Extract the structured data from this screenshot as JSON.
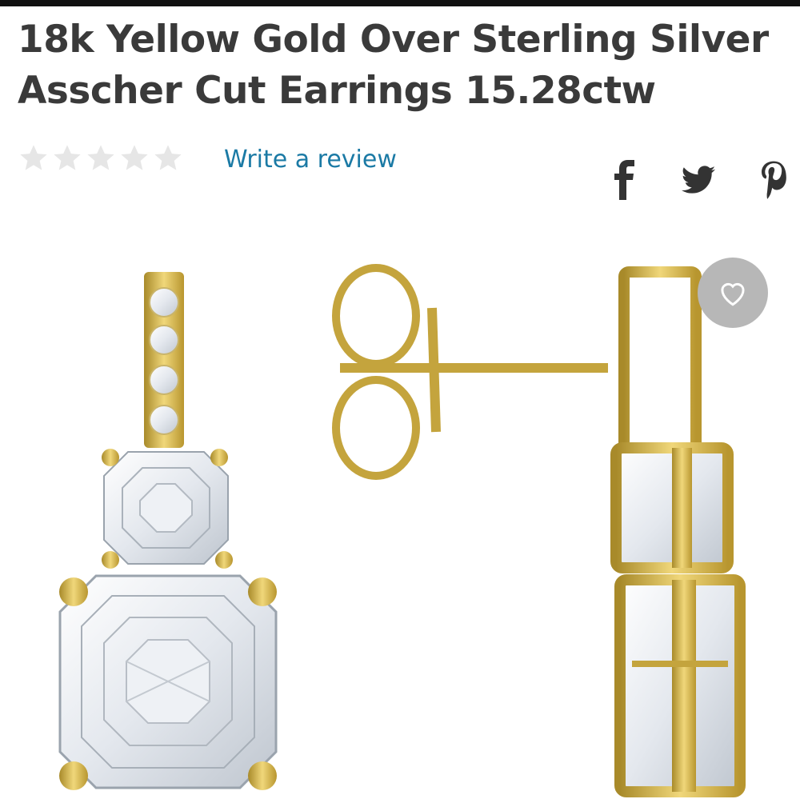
{
  "product": {
    "title": "18k Yellow Gold Over Sterling Silver Asscher Cut Earrings 15.28ctw"
  },
  "rating": {
    "stars_filled": 0,
    "stars_total": 5
  },
  "review": {
    "link_label": "Write a review"
  },
  "share": {
    "icons": [
      "facebook-icon",
      "twitter-icon",
      "pinterest-icon"
    ]
  },
  "wishlist": {
    "icon": "heart-icon"
  },
  "colors": {
    "title": "#3a3a3a",
    "link": "#1b7aa5",
    "star_empty": "#e6e6e6",
    "gold": "#d4af37",
    "wishlist_bg": "#b7b7b7"
  }
}
